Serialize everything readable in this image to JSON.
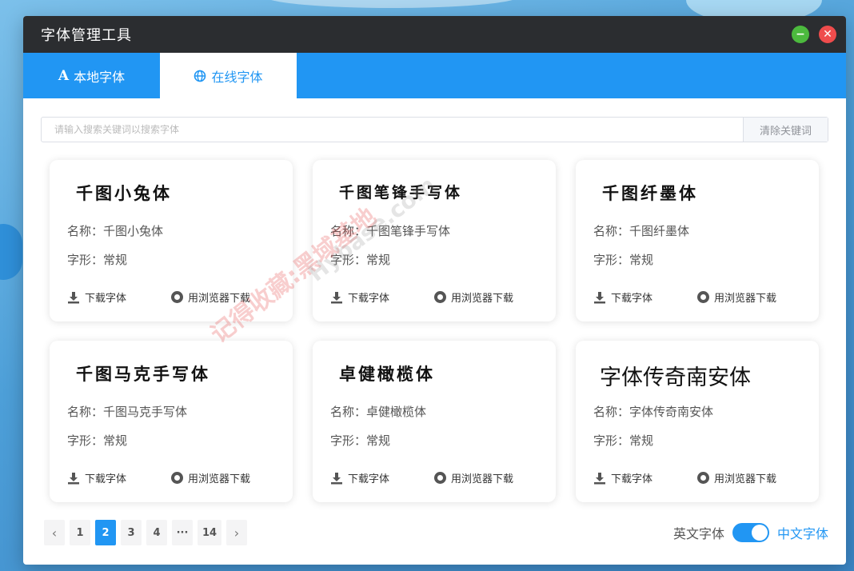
{
  "window": {
    "title": "字体管理工具",
    "minimize_icon": "minus-icon",
    "close_icon": "close-icon"
  },
  "tabs": [
    {
      "icon": "A",
      "icon_name": "font-letter-icon",
      "label": "本地字体",
      "active": false
    },
    {
      "icon": "globe",
      "icon_name": "globe-icon",
      "label": "在线字体",
      "active": true
    }
  ],
  "search": {
    "placeholder": "请输入搜索关键词以搜索字体",
    "value": "",
    "clear_label": "清除关键词"
  },
  "cards": [
    {
      "preview": "千图小兔体",
      "name_label": "名称：",
      "name": "千图小兔体",
      "style_label": "字形：",
      "style": "常规",
      "download_label": "下载字体",
      "browser_label": "用浏览器下载"
    },
    {
      "preview": "千图笔锋手写体",
      "name_label": "名称：",
      "name": "千图笔锋手写体",
      "style_label": "字形：",
      "style": "常规",
      "download_label": "下载字体",
      "browser_label": "用浏览器下载"
    },
    {
      "preview": "千图纤墨体",
      "name_label": "名称：",
      "name": "千图纤墨体",
      "style_label": "字形：",
      "style": "常规",
      "download_label": "下载字体",
      "browser_label": "用浏览器下载"
    },
    {
      "preview": "千图马克手写体",
      "name_label": "名称：",
      "name": "千图马克手写体",
      "style_label": "字形：",
      "style": "常规",
      "download_label": "下载字体",
      "browser_label": "用浏览器下载"
    },
    {
      "preview": "卓健橄榄体",
      "name_label": "名称：",
      "name": "卓健橄榄体",
      "style_label": "字形：",
      "style": "常规",
      "download_label": "下载字体",
      "browser_label": "用浏览器下载"
    },
    {
      "preview": "字体传奇南安体",
      "name_label": "名称：",
      "name": "字体传奇南安体",
      "style_label": "字形：",
      "style": "常规",
      "download_label": "下载字体",
      "browser_label": "用浏览器下载"
    }
  ],
  "pagination": {
    "prev": "‹",
    "pages": [
      "1",
      "2",
      "3",
      "4",
      "···",
      "14"
    ],
    "current": "2",
    "next": "›"
  },
  "language_toggle": {
    "left_label": "英文字体",
    "right_label": "中文字体",
    "selected": "中文字体"
  },
  "watermarks": [
    "记得收藏:黑域基地",
    "Hybase.com"
  ],
  "colors": {
    "accent": "#2196f3",
    "titlebar": "#2b2d30",
    "minimize": "#4cba3e",
    "close": "#ef4c4c"
  }
}
